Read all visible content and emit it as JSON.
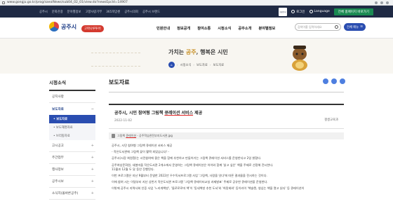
{
  "browser": {
    "url": "www.gongju.go.kr/prog/saeolNews/sub04_02_01/view.do?newsEpcId=14907"
  },
  "topbar": {
    "links": [
      "공주시",
      "문화관광",
      "분야별정보",
      "고향사랑기부",
      "365희망센",
      "공주시의회",
      "공주시 브랜드"
    ],
    "gov_badge": "대한민국",
    "login": "로그인",
    "language": "Language",
    "all_sites": "전체 홈페이지 바로가기"
  },
  "header": {
    "logo": "공주시",
    "tour_badge": "고마나루투어",
    "nav": [
      "민원안내",
      "정보공개",
      "참여소통",
      "시정소식",
      "공주소개",
      "분야별정보"
    ],
    "search_placeholder": "검색어를 입력하세요",
    "menu_button": "전체 메뉴"
  },
  "banner": {
    "slogan_pre": "가치는 ",
    "slogan_em": "공주",
    "slogan_post": ", 행복은 시민"
  },
  "breadcrumb": [
    "시정소식",
    "보도자료",
    "보도자료"
  ],
  "sidebar": {
    "title": "시정소식",
    "items": [
      {
        "label": "공지사항"
      },
      {
        "label": "보도자료"
      },
      {
        "label": "고시공고"
      },
      {
        "label": "주간업무"
      },
      {
        "label": "행사정보"
      },
      {
        "label": "공주시보"
      },
      {
        "label": "소식지(올바른공주)"
      }
    ],
    "sub_items": [
      "보도자료",
      "보도해명자료",
      "브리핑자료"
    ]
  },
  "content": {
    "page_title": "보도자료",
    "article_title_pre": "공주시, 시민 참여형 그림책 ",
    "article_title_hl": "큐레이션 서비스",
    "article_title_post": " 제공",
    "date": "2022-11-02",
    "dept": "평생교육과",
    "attachment_pre": "그림책 ",
    "attachment_hl": "큐레이션",
    "attachment_post": " - 공주학습관전부지도서관.jpg",
    "paragraphs": [
      "공주시, 시민 참여형 그림책 큐레이션 서비스 제공",
      "- 작은도서관에 그림책 꽃이 활짝 피었습니다! -",
      "공주시(시장 최원철)는 시민참여에 좋은 책을 함께 추천하고 만들어가는 그림책 큐레이션 서비스를 운영한다고 2일 밝혔다.",
      "공주여성문화원, 새봄마을 작은도서관 2개소에서 운영하는 그림책 큐레이션은 아이와 함께 '읽고 싶은' 책을 주제로 선정해 전시한다.",
      "11월과 12월 두 달 동안 진행된다.",
      "이번 프로그램은 지난 9월부터 운영한 2022년 우수독서프로그램 사업 '그림책, 사람을 잇다'에 따른 결과물을 전시하는 것이다.",
      "이에 참여 시는 이달부터 지난 상반기 작은도서관 프로그램 '그림책 큐레이터교실 과제발표' 주제로 공유한 큐레이션을 운영한다.",
      "이밖에 공주시 지역사회 인증 사업 '느리게책방', '돌로로로마 책'이 '동네책방 추천 도서'와 '희망회와' 등이라이 '책슬렌, 영심는 책을 열고 읽다' 등 큐레이션이"
    ]
  }
}
